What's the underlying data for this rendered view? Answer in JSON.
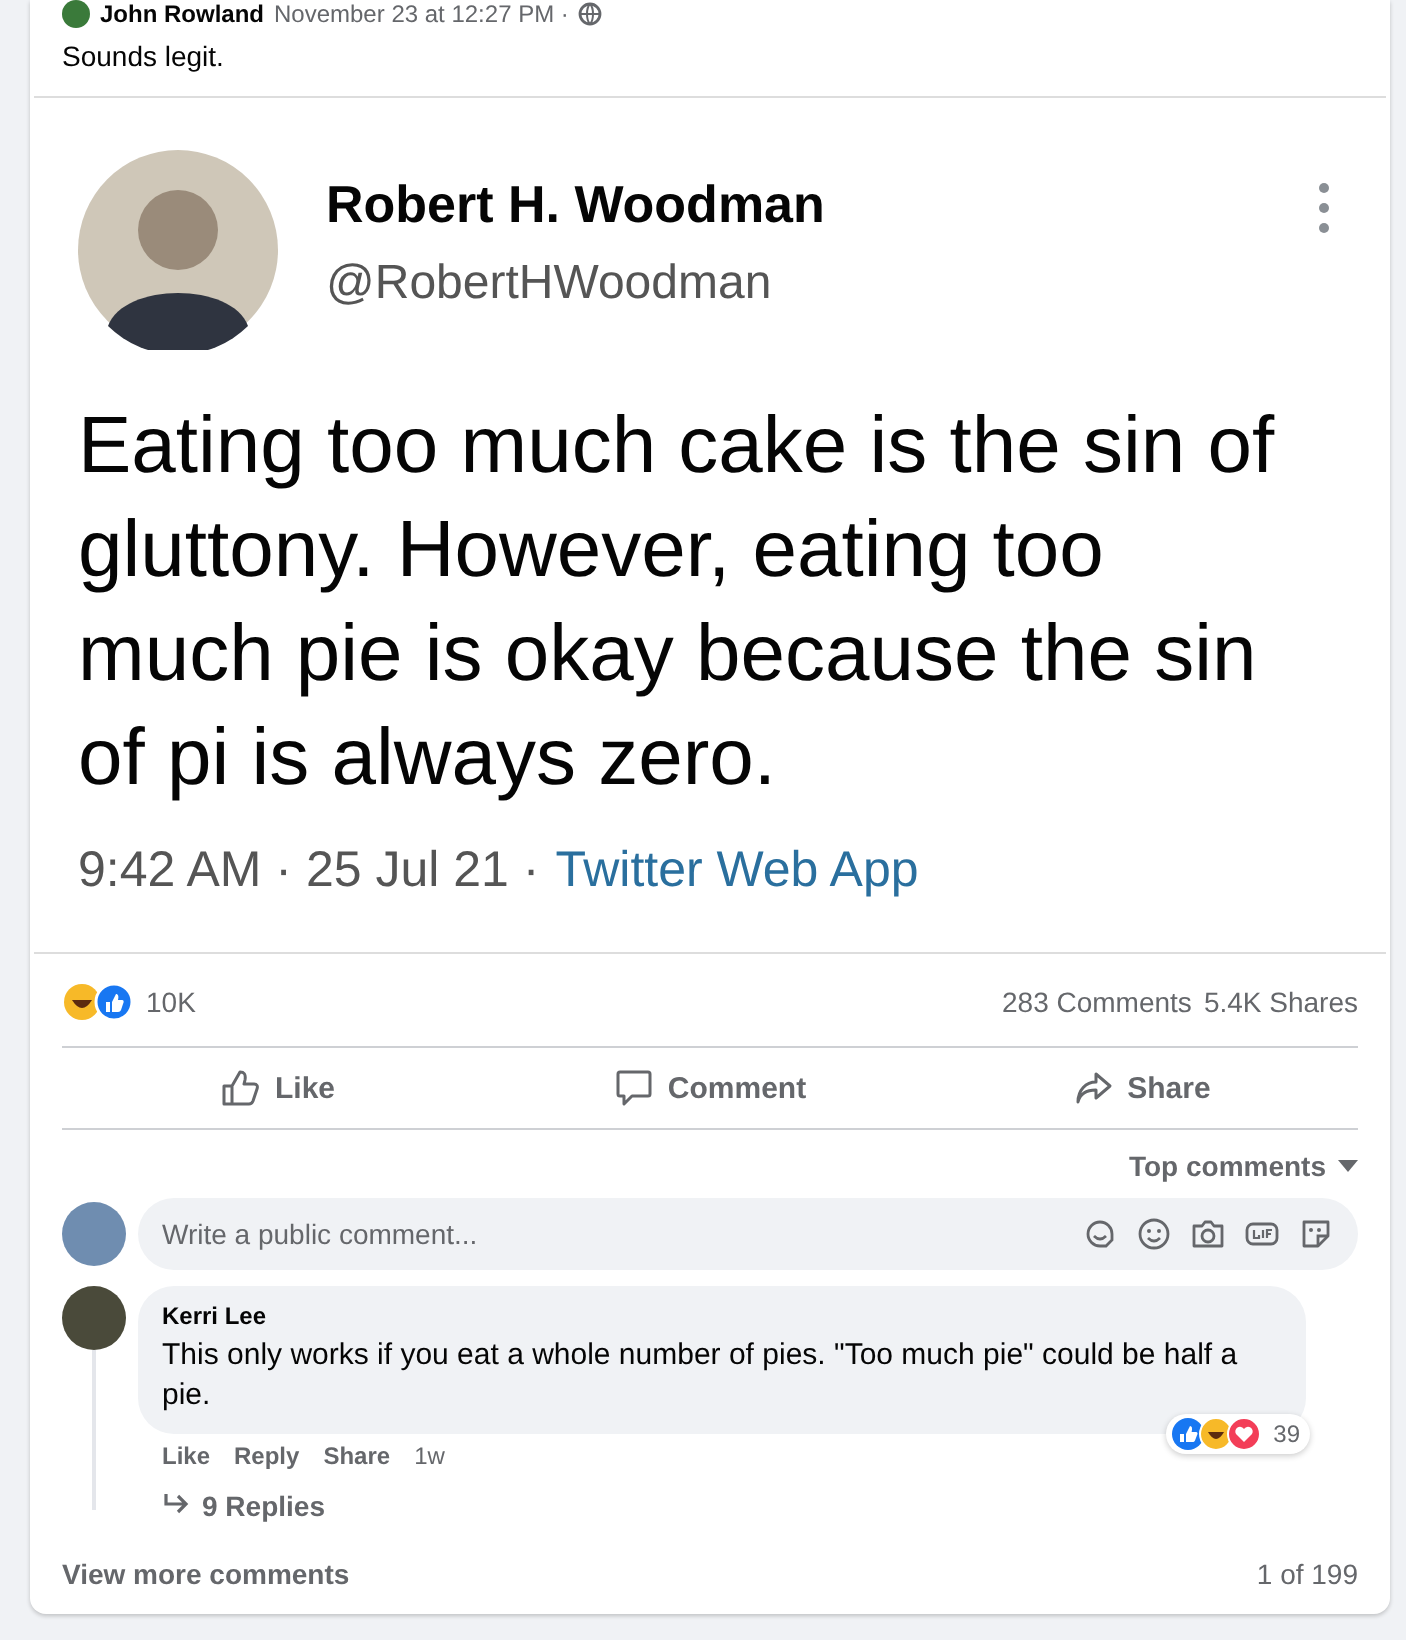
{
  "post": {
    "author": "John Rowland",
    "time": "November 23 at 12:27 PM ·",
    "text": "Sounds legit."
  },
  "tweet": {
    "name": "Robert H. Woodman",
    "handle": "@RobertHWoodman",
    "text": "Eating too much cake is the sin of gluttony. However, eating too much pie is okay because the sin of pi is always zero.",
    "meta": "9:42 AM · 25 Jul 21 ·",
    "source": "Twitter Web App"
  },
  "stats": {
    "reactions": "10K",
    "comments": "283 Comments",
    "shares": "5.4K Shares"
  },
  "actions": [
    {
      "kind": "like",
      "label": "Like"
    },
    {
      "kind": "comment",
      "label": "Comment"
    },
    {
      "kind": "share",
      "label": "Share"
    }
  ],
  "sort": "Top comments",
  "composer": {
    "placeholder": "Write a public comment..."
  },
  "comments": [
    {
      "author": "Kerri Lee",
      "text": "This only works if you eat a whole number of pies. \"Too much pie\" could be half a pie.",
      "links": [
        "Like",
        "Reply",
        "Share"
      ],
      "age": "1w",
      "reaction_count": "39",
      "replies": "9 Replies"
    }
  ],
  "footer": {
    "view_more": "View more comments",
    "count": "1 of 199"
  }
}
